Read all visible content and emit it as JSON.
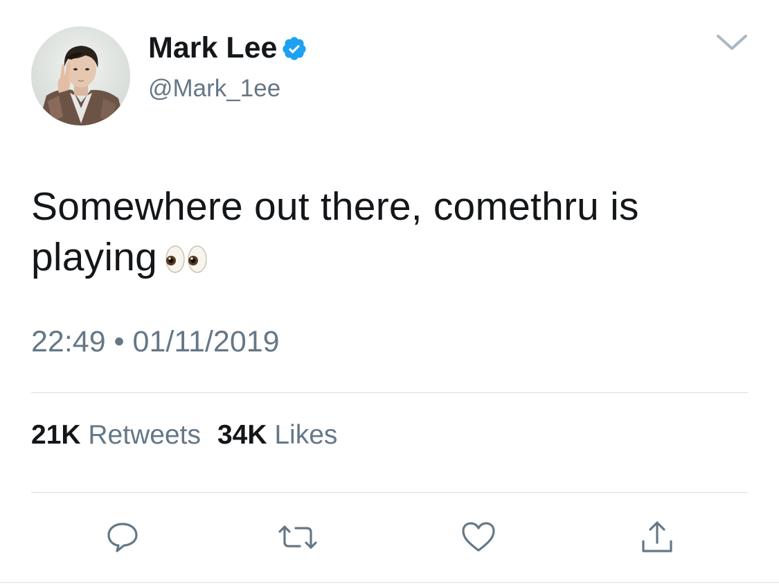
{
  "user": {
    "display_name": "Mark Lee",
    "handle": "@Mark_1ee",
    "verified": true
  },
  "tweet": {
    "text": "Somewhere out there, comethru is playing",
    "emoji": "eyes-emoji",
    "timestamp": "22:49 • 01/11/2019"
  },
  "stats": {
    "retweets_count": "21K",
    "retweets_label": "Retweets",
    "likes_count": "34K",
    "likes_label": "Likes"
  },
  "actions": [
    {
      "name": "reply",
      "icon": "reply-icon"
    },
    {
      "name": "retweet",
      "icon": "retweet-icon"
    },
    {
      "name": "like",
      "icon": "heart-icon"
    },
    {
      "name": "share",
      "icon": "share-icon"
    }
  ],
  "colors": {
    "text_primary": "#14171a",
    "text_secondary": "#657786",
    "verified_blue": "#1da1f2",
    "divider": "#d8dee2",
    "icon_gray": "#657786"
  }
}
